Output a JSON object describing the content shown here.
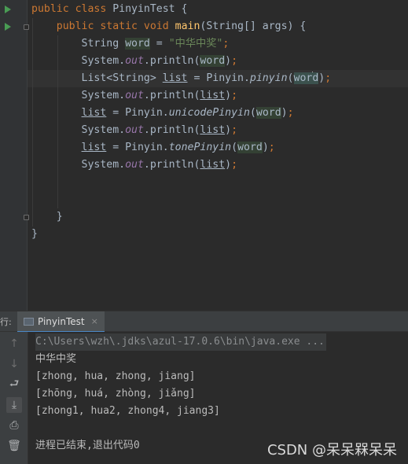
{
  "editor": {
    "lines": [
      {
        "tokens": [
          {
            "t": "public class ",
            "c": "kw"
          },
          {
            "t": "PinyinTest {",
            "c": ""
          }
        ]
      },
      {
        "tokens": [
          {
            "t": "    public static void ",
            "c": "kw"
          },
          {
            "t": "main",
            "c": "fn"
          },
          {
            "t": "(String[] args) {",
            "c": ""
          }
        ]
      },
      {
        "tokens": [
          {
            "t": "        String ",
            "c": ""
          },
          {
            "t": "word",
            "c": "var"
          },
          {
            "t": " = ",
            "c": ""
          },
          {
            "t": "\"中华中奖\"",
            "c": "str"
          },
          {
            "t": ";",
            "c": "kw"
          }
        ]
      },
      {
        "tokens": [
          {
            "t": "        System.",
            "c": ""
          },
          {
            "t": "out",
            "c": "fld"
          },
          {
            "t": ".println(",
            "c": ""
          },
          {
            "t": "word",
            "c": "var"
          },
          {
            "t": ")",
            "c": ""
          },
          {
            "t": ";",
            "c": "kw"
          }
        ]
      },
      {
        "tokens": [
          {
            "t": "        List<String> ",
            "c": ""
          },
          {
            "t": "list",
            "c": "ul"
          },
          {
            "t": " = Pinyin.",
            "c": ""
          },
          {
            "t": "pinyin",
            "c": "it"
          },
          {
            "t": "(",
            "c": ""
          },
          {
            "t": "wor",
            "c": "var2"
          },
          {
            "t": "",
            "c": "caret"
          },
          {
            "t": "d",
            "c": "var2"
          },
          {
            "t": ")",
            "c": ""
          },
          {
            "t": ";",
            "c": "kw"
          }
        ]
      },
      {
        "tokens": [
          {
            "t": "        System.",
            "c": ""
          },
          {
            "t": "out",
            "c": "fld"
          },
          {
            "t": ".println(",
            "c": ""
          },
          {
            "t": "list",
            "c": "ul"
          },
          {
            "t": ")",
            "c": ""
          },
          {
            "t": ";",
            "c": "kw"
          }
        ]
      },
      {
        "tokens": [
          {
            "t": "        ",
            "c": ""
          },
          {
            "t": "list",
            "c": "ul"
          },
          {
            "t": " = Pinyin.",
            "c": ""
          },
          {
            "t": "unicodePinyin",
            "c": "it"
          },
          {
            "t": "(",
            "c": ""
          },
          {
            "t": "word",
            "c": "var"
          },
          {
            "t": ")",
            "c": ""
          },
          {
            "t": ";",
            "c": "kw"
          }
        ]
      },
      {
        "tokens": [
          {
            "t": "        System.",
            "c": ""
          },
          {
            "t": "out",
            "c": "fld"
          },
          {
            "t": ".println(",
            "c": ""
          },
          {
            "t": "list",
            "c": "ul"
          },
          {
            "t": ")",
            "c": ""
          },
          {
            "t": ";",
            "c": "kw"
          }
        ]
      },
      {
        "tokens": [
          {
            "t": "        ",
            "c": ""
          },
          {
            "t": "list",
            "c": "ul"
          },
          {
            "t": " = Pinyin.",
            "c": ""
          },
          {
            "t": "tonePinyin",
            "c": "it"
          },
          {
            "t": "(",
            "c": ""
          },
          {
            "t": "word",
            "c": "var"
          },
          {
            "t": ")",
            "c": ""
          },
          {
            "t": ";",
            "c": "kw"
          }
        ]
      },
      {
        "tokens": [
          {
            "t": "        System.",
            "c": ""
          },
          {
            "t": "out",
            "c": "fld"
          },
          {
            "t": ".println(",
            "c": ""
          },
          {
            "t": "list",
            "c": "ul"
          },
          {
            "t": ")",
            "c": ""
          },
          {
            "t": ";",
            "c": "kw"
          }
        ]
      },
      {
        "tokens": []
      },
      {
        "tokens": []
      },
      {
        "tokens": [
          {
            "t": "    }",
            "c": ""
          }
        ]
      },
      {
        "tokens": [
          {
            "t": "}",
            "c": ""
          }
        ]
      }
    ]
  },
  "run_tab": {
    "prefix": "行:",
    "label": "PinyinTest",
    "close_glyph": "×",
    "icon": "application-window-icon"
  },
  "console": {
    "tools": [
      {
        "name": "arrow-up-icon",
        "glyph": "↑",
        "state": "off"
      },
      {
        "name": "arrow-down-icon",
        "glyph": "↓",
        "state": "off"
      },
      {
        "name": "soft-wrap-icon",
        "glyph": "⮐",
        "state": "on"
      },
      {
        "name": "scroll-to-end-icon",
        "glyph": "⤓",
        "state": "sel"
      },
      {
        "name": "print-icon",
        "glyph": "⎙",
        "state": "on"
      },
      {
        "name": "trash-icon",
        "glyph": "🗑",
        "state": "on"
      }
    ],
    "command": "C:\\Users\\wzh\\.jdks\\azul-17.0.6\\bin\\java.exe ...",
    "output": [
      "中华中奖",
      "[zhong, hua, zhong, jiang]",
      "[zhōng, huá, zhòng, jiǎng]",
      "[zhong1, hua2, zhong4, jiang3]",
      "",
      "进程已结束,退出代码0"
    ]
  },
  "watermark": "CSDN @呆呆槑呆呆",
  "colors": {
    "background": "#2b2b2b",
    "keyword": "#cc7832",
    "method": "#ffc66d",
    "string": "#6a8759",
    "static_field": "#9876aa",
    "run_arrow": "#499c54",
    "tab_underline": "#4a88c7"
  }
}
